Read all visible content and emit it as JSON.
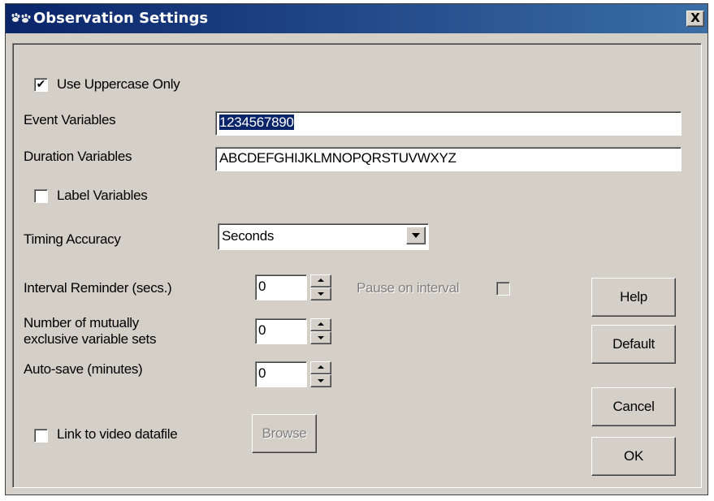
{
  "window": {
    "title": "Observation Settings",
    "close_label": "X"
  },
  "form": {
    "uppercase": {
      "label": "Use Uppercase Only",
      "checked": true,
      "mark": "✔"
    },
    "event_variables": {
      "label": "Event Variables",
      "value": "1234567890"
    },
    "duration_variables": {
      "label": "Duration Variables",
      "value": "ABCDEFGHIJKLMNOPQRSTUVWXYZ"
    },
    "label_variables": {
      "label": "Label Variables",
      "checked": false
    },
    "timing_accuracy": {
      "label": "Timing Accuracy",
      "selected": "Seconds"
    },
    "interval_reminder": {
      "label": "Interval Reminder (secs.)",
      "value": "0"
    },
    "pause_on_interval": {
      "label": "Pause on interval",
      "checked": false,
      "disabled": true
    },
    "mutually_exclusive": {
      "label_line1": "Number of mutually",
      "label_line2": "exclusive variable sets",
      "value": "0"
    },
    "auto_save": {
      "label": "Auto-save (minutes)",
      "value": "0"
    },
    "link_video": {
      "label": "Link to video datafile",
      "checked": false
    },
    "browse_label": "Browse"
  },
  "buttons": {
    "help": "Help",
    "default": "Default",
    "cancel": "Cancel",
    "ok": "OK"
  },
  "colors": {
    "title_gradient_start": "#0a246a",
    "title_gradient_end": "#3a6ea5",
    "dialog_face": "#d4d0c8",
    "selection": "#0a246a"
  }
}
